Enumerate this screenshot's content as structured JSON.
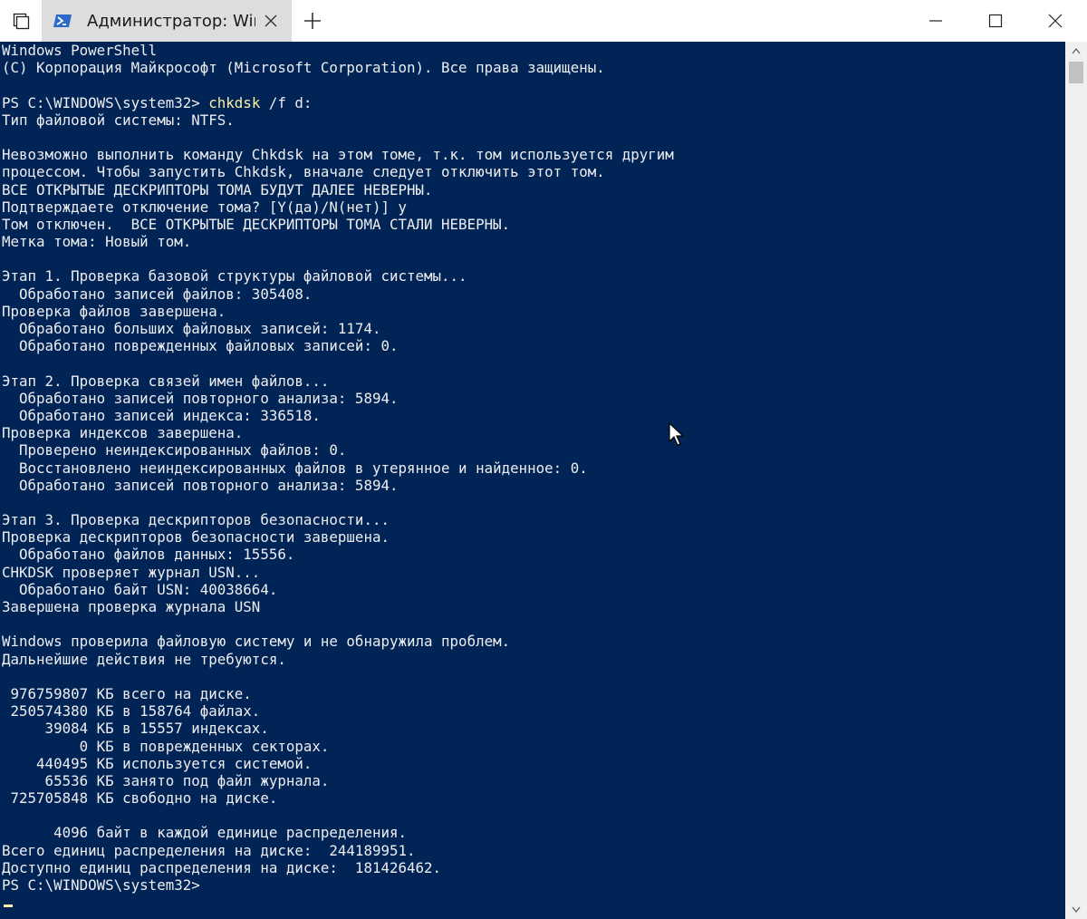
{
  "window": {
    "tab_title": "Администратор: Wind",
    "tab_icon": "powershell-icon",
    "controls": {
      "minimize": "minimize-icon",
      "maximize": "maximize-icon",
      "close": "close-icon"
    }
  },
  "colors": {
    "console_background": "#012456",
    "console_text": "#eeedf0",
    "command_text": "#f9f1a5"
  },
  "console": {
    "lines": [
      "Windows PowerShell",
      "(C) Корпорация Майкрософт (Microsoft Corporation). Все права защищены.",
      "",
      "PS C:\\WINDOWS\\system32> ",
      "Тип файловой системы: NTFS.",
      "",
      "Невозможно выполнить команду Chkdsk на этом томе, т.к. том используется другим",
      "процессом. Чтобы запустить Chkdsk, вначале следует отключить этот том.",
      "ВСЕ ОТКРЫТЫЕ ДЕСКРИПТОРЫ ТОМА БУДУТ ДАЛЕЕ НЕВЕРНЫ.",
      "Подтверждаете отключение тома? [Y(да)/N(нет)] y",
      "Том отключен.  ВСЕ ОТКРЫТЫЕ ДЕСКРИПТОРЫ ТОМА СТАЛИ НЕВЕРНЫ.",
      "Метка тома: Новый том.",
      "",
      "Этап 1. Проверка базовой структуры файловой системы...",
      "  Обработано записей файлов: 305408.",
      "Проверка файлов завершена.",
      "  Обработано больших файловых записей: 1174.",
      "  Обработано поврежденных файловых записей: 0.",
      "",
      "Этап 2. Проверка связей имен файлов...",
      "  Обработано записей повторного анализа: 5894.",
      "  Обработано записей индекса: 336518.",
      "Проверка индексов завершена.",
      "  Проверено неиндексированных файлов: 0.",
      "  Восстановлено неиндексированных файлов в утерянное и найденное: 0.",
      "  Обработано записей повторного анализа: 5894.",
      "",
      "Этап 3. Проверка дескрипторов безопасности...",
      "Проверка дескрипторов безопасности завершена.",
      "  Обработано файлов данных: 15556.",
      "CHKDSK проверяет журнал USN...",
      "  Обработано байт USN: 40038664.",
      "Завершена проверка журнала USN",
      "",
      "Windows проверила файловую систему и не обнаружила проблем.",
      "Дальнейшие действия не требуются.",
      "",
      " 976759807 КБ всего на диске.",
      " 250574380 КБ в 158764 файлах.",
      "     39084 КБ в 15557 индексах.",
      "         0 КБ в поврежденных секторах.",
      "    440495 КБ используется системой.",
      "     65536 КБ занято под файл журнала.",
      " 725705848 КБ свободно на диске.",
      "",
      "      4096 байт в каждой единице распределения.",
      "Всего единиц распределения на диске:  244189951.",
      "Доступно единиц распределения на диске:  181426462.",
      "PS C:\\WINDOWS\\system32> "
    ],
    "command": "chkdsk",
    "command_args": " /f d:"
  }
}
